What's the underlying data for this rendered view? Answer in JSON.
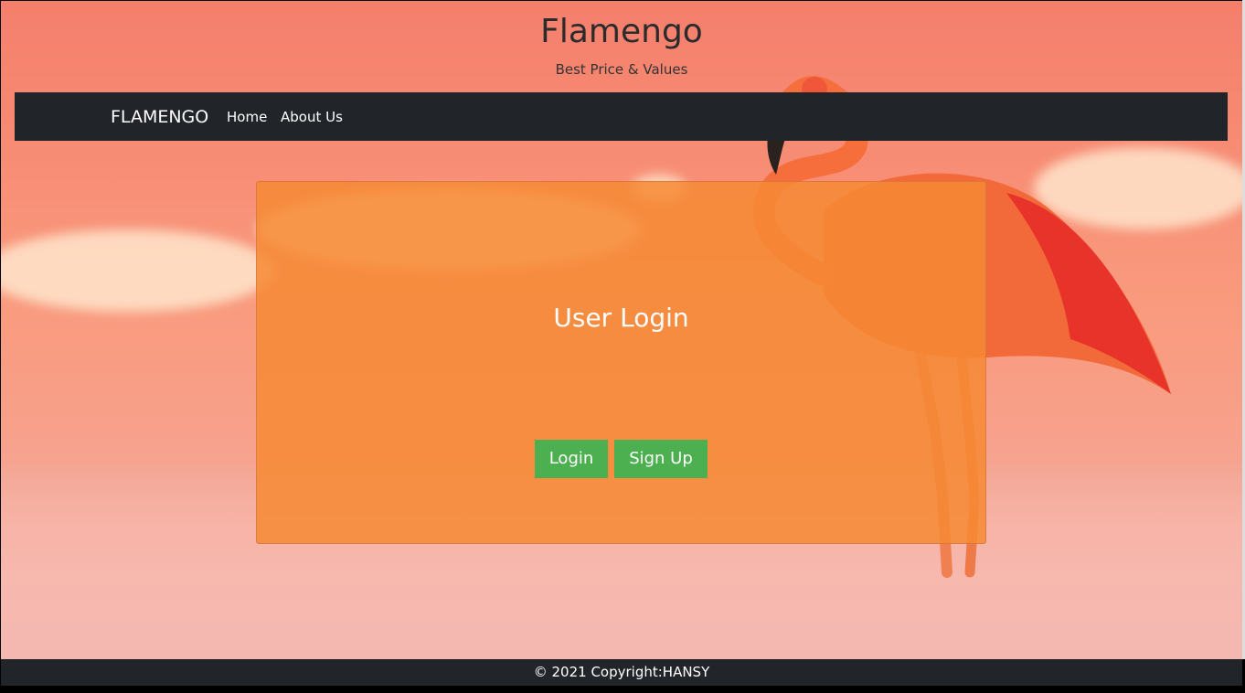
{
  "header": {
    "title": "Flamengo",
    "subtitle": "Best Price & Values"
  },
  "navbar": {
    "brand": "FLAMENGO",
    "links": [
      {
        "label": "Home"
      },
      {
        "label": "About Us"
      }
    ]
  },
  "login_card": {
    "title": "User Login",
    "login_button": "Login",
    "signup_button": "Sign Up"
  },
  "footer": {
    "copyright": "© 2021 Copyright:HANSY"
  },
  "colors": {
    "navbar_bg": "#212529",
    "card_bg": "#f68a34",
    "button_bg": "#4caf50"
  }
}
